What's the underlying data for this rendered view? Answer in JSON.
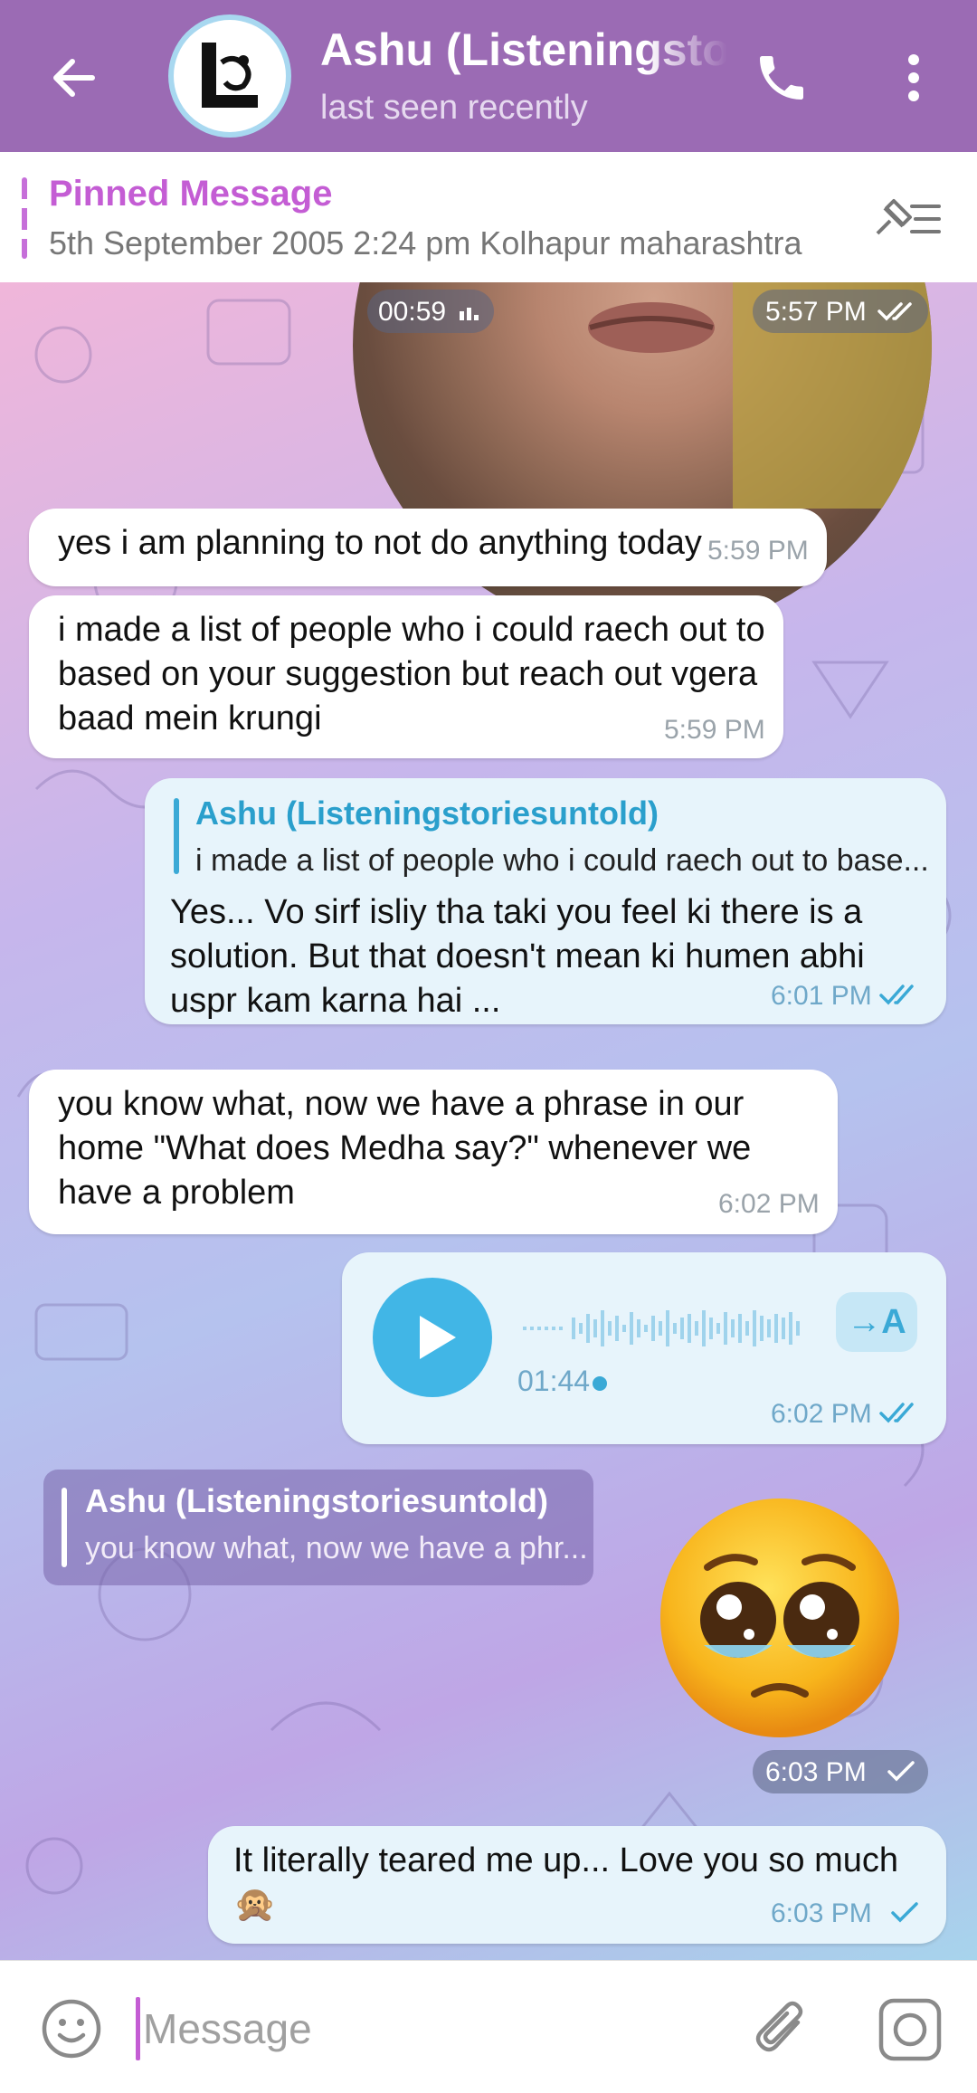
{
  "header": {
    "title": "Ashu (Listeningstoriesuntold)",
    "status": "last seen recently",
    "back_icon": "arrow-left-icon",
    "call_icon": "phone-icon",
    "more_icon": "more-vert-icon"
  },
  "pinned": {
    "label": "Pinned Message",
    "text": "5th September 2005 2:24 pm Kolhapur maharashtra",
    "icon": "pinned-list-icon"
  },
  "chat": {
    "video_message": {
      "duration": "00:59",
      "time": "5:57 PM"
    },
    "messages": [
      {
        "text": "yes i am planning to not do anything today",
        "time": "5:59 PM"
      },
      {
        "text": "i made a list of people who i could raech out to based on your suggestion but reach out vgera baad mein krungi",
        "time": "5:59 PM"
      },
      {
        "reply_name": "Ashu (Listeningstoriesuntold)",
        "reply_text": "i made a list of people who i could raech out to base...",
        "text": "Yes... Vo sirf isliy tha taki you feel ki there is a solution. But that doesn't mean ki humen abhi uspr kam karna hai ...",
        "time": "6:01 PM"
      },
      {
        "text": "you know what, now we have a phrase in our home \"What does Medha say?\" whenever we have a problem",
        "time": "6:02 PM"
      },
      {
        "voice_duration": "01:44",
        "translate_label": "→A",
        "time": "6:02 PM"
      },
      {
        "reply_name": "Ashu (Listeningstoriesuntold)",
        "reply_text": "you know what, now we have a phr...",
        "emoji": "🥹",
        "time": "6:03 PM"
      },
      {
        "text": "It literally teared me up... Love you so much 🙊",
        "time": "6:03 PM"
      }
    ]
  },
  "input": {
    "placeholder": "Message",
    "emoji_icon": "emoji-smile-icon",
    "attach_icon": "paperclip-icon",
    "camera_icon": "camera-icon"
  },
  "colors": {
    "header": "#9b6bb4",
    "accent": "#c45dd4",
    "outgoing_bubble": "#e7f4fb",
    "incoming_bubble": "#ffffff",
    "link_blue": "#3aa9d6"
  }
}
